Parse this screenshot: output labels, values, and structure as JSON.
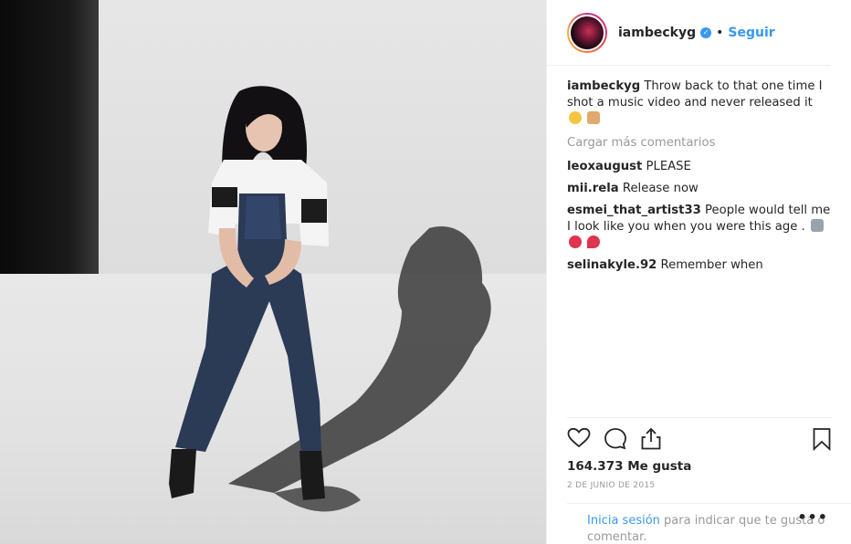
{
  "post": {
    "username": "iambeckyg",
    "dot": "•",
    "follow_label": "Seguir",
    "caption": "Throw back to that one time I shot a music video and never released it",
    "load_more_label": "Cargar más comentarios",
    "comments": [
      {
        "user": "leoxaugust",
        "text": "PLEASE"
      },
      {
        "user": "mii.rela",
        "text": "Release now"
      },
      {
        "user": "esmei_that_artist33",
        "text": "People would tell me I look like you when you were this age ."
      },
      {
        "user": "selinakyle.92",
        "text": "Remember when"
      }
    ],
    "likes_label": "164.373 Me gusta",
    "date_label": "2 DE JUNIO DE 2015",
    "login_link": "Inicia sesión",
    "login_text": " para indicar que te gusta o comentar.",
    "more_label": "•••"
  },
  "icons": {
    "verified": "verified-badge-icon",
    "like": "heart-icon",
    "comment": "comment-bubble-icon",
    "share": "share-icon",
    "save": "bookmark-icon",
    "more": "more-options-icon"
  },
  "colors": {
    "link_blue": "#3897f0",
    "text": "#262626",
    "muted": "#999999"
  }
}
